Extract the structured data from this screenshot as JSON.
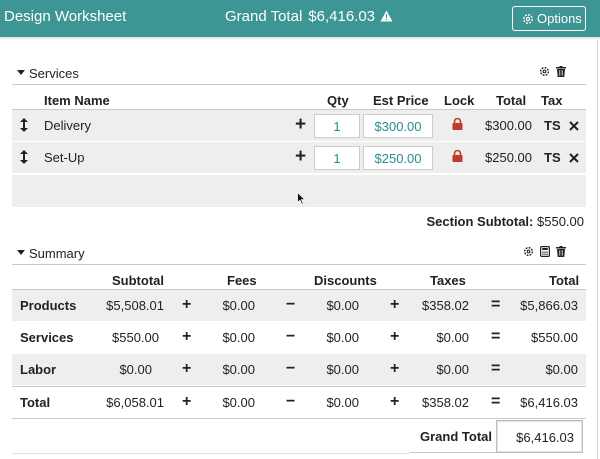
{
  "header": {
    "title": "Design Worksheet",
    "grand_total_label": "Grand Total",
    "grand_total_value": "$6,416.03",
    "options_label": "Options"
  },
  "services": {
    "section_name": "Services",
    "columns": {
      "item_name": "Item Name",
      "qty": "Qty",
      "est_price": "Est Price",
      "lock": "Lock",
      "total": "Total",
      "tax": "Tax"
    },
    "rows": [
      {
        "name": "Delivery",
        "qty": "1",
        "price": "$300.00",
        "total": "$300.00",
        "tax": "TS"
      },
      {
        "name": "Set-Up",
        "qty": "1",
        "price": "$250.00",
        "total": "$250.00",
        "tax": "TS"
      }
    ],
    "subtotal_label": "Section Subtotal:",
    "subtotal_value": "$550.00"
  },
  "summary": {
    "section_name": "Summary",
    "columns": {
      "subtotal": "Subtotal",
      "fees": "Fees",
      "discounts": "Discounts",
      "taxes": "Taxes",
      "total": "Total"
    },
    "rows": [
      {
        "label": "Products",
        "subtotal": "$5,508.01",
        "fees": "$0.00",
        "discounts": "$0.00",
        "taxes": "$358.02",
        "total": "$5,866.03"
      },
      {
        "label": "Services",
        "subtotal": "$550.00",
        "fees": "$0.00",
        "discounts": "$0.00",
        "taxes": "$0.00",
        "total": "$550.00"
      },
      {
        "label": "Labor",
        "subtotal": "$0.00",
        "fees": "$0.00",
        "discounts": "$0.00",
        "taxes": "$0.00",
        "total": "$0.00"
      },
      {
        "label": "Total",
        "subtotal": "$6,058.01",
        "fees": "$0.00",
        "discounts": "$0.00",
        "taxes": "$358.02",
        "total": "$6,416.03"
      }
    ],
    "operators": {
      "plus": "+",
      "minus": "−",
      "equals": "="
    },
    "grand_total_label": "Grand Total",
    "grand_total_value": "$6,416.03"
  },
  "icons": {
    "warning": "warning-icon",
    "gear": "gear-icon",
    "trash": "trash-icon",
    "calculator": "calculator-icon",
    "drag": "drag-handle-icon",
    "lock": "lock-icon",
    "delete": "close-icon"
  },
  "colors": {
    "header_bg": "#3d9694",
    "accent_text": "#2c8a91",
    "lock_red": "#c0392b",
    "row_shade": "#eeeeee"
  }
}
